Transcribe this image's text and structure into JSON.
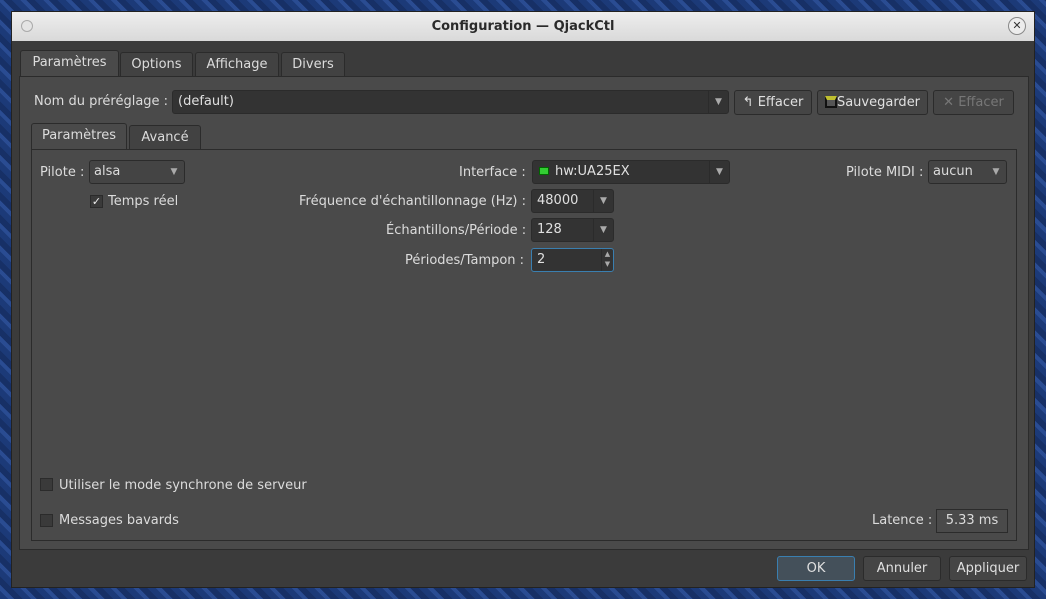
{
  "window": {
    "title": "Configuration — QjackCtl"
  },
  "tabs": [
    "Paramètres",
    "Options",
    "Affichage",
    "Divers"
  ],
  "preset": {
    "label": "Nom du préréglage :",
    "value": "(default)",
    "clear_label": "Effacer",
    "save_label": "Sauvegarder",
    "delete_label": "Effacer"
  },
  "subtabs": [
    "Paramètres",
    "Avancé"
  ],
  "params": {
    "driver_label": "Pilote :",
    "driver": "alsa",
    "realtime_label": "Temps réel",
    "realtime": true,
    "interface_label": "Interface :",
    "interface": "hw:UA25EX",
    "midi_label": "Pilote MIDI :",
    "midi": "aucun",
    "rate_label": "Fréquence d'échantillonnage (Hz) :",
    "rate": "48000",
    "frames_label": "Échantillons/Période :",
    "frames": "128",
    "periods_label": "Périodes/Tampon :",
    "periods": "2",
    "sync_label": "Utiliser le mode synchrone de serveur",
    "sync": false,
    "verbose_label": "Messages bavards",
    "verbose": false,
    "latency_label": "Latence :",
    "latency": "5.33 ms"
  },
  "buttons": {
    "ok": "OK",
    "cancel": "Annuler",
    "apply": "Appliquer"
  },
  "colors": {
    "accent": "#3a7fb0",
    "window_bg": "#3b3b3b"
  }
}
